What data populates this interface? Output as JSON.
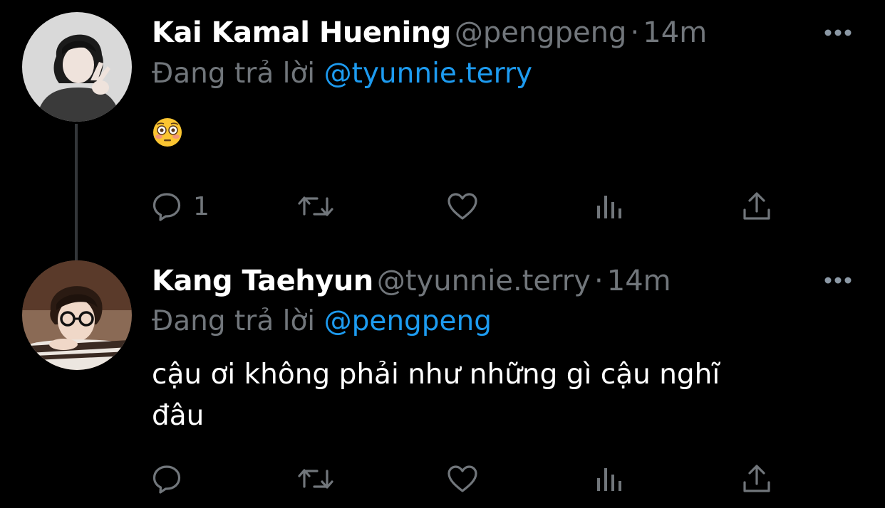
{
  "colors": {
    "background": "#000000",
    "name": "#ffffff",
    "secondary": "#71767b",
    "link": "#1d9bf0",
    "icon": "#71767b"
  },
  "tweets": [
    {
      "display_name": "Kai Kamal Huening",
      "handle": "@pengpeng",
      "dot": "·",
      "time": "14m",
      "reply_prefix": "Đang trả lời",
      "reply_mention": "@tyunnie.terry",
      "body_emoji": "flushed-face-emoji",
      "reply_count": "1",
      "icons": [
        "reply-icon",
        "retweet-icon",
        "like-icon",
        "views-icon",
        "share-icon",
        "more-icon"
      ]
    },
    {
      "display_name": "Kang Taehyun",
      "handle": "@tyunnie.terry",
      "dot": "·",
      "time": "14m",
      "reply_prefix": "Đang trả lời",
      "reply_mention": "@pengpeng",
      "body_line1": "cậu ơi không phải như những gì cậu nghĩ",
      "body_line2": "đâu",
      "reply_count": "",
      "icons": [
        "reply-icon",
        "retweet-icon",
        "like-icon",
        "views-icon",
        "share-icon",
        "more-icon"
      ]
    }
  ]
}
